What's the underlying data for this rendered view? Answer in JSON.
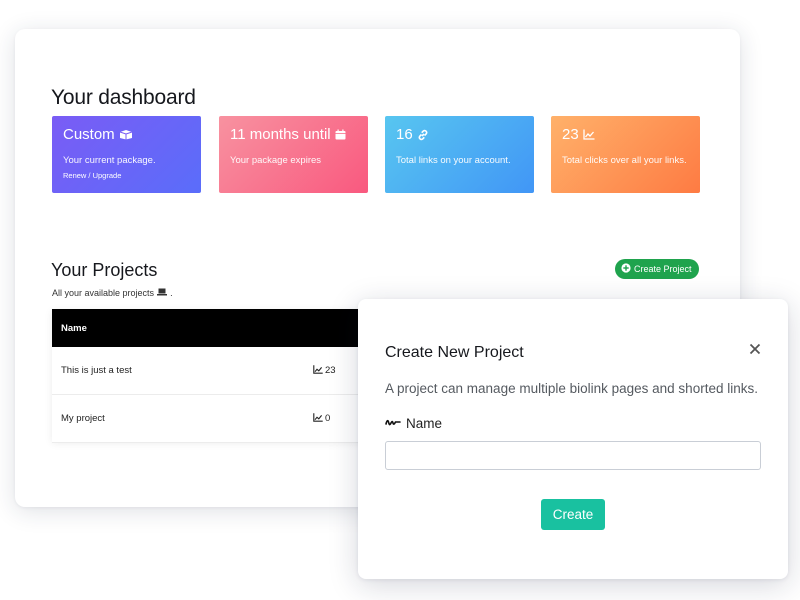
{
  "dashboard": {
    "title": "Your dashboard",
    "cards": [
      {
        "title": "Custom",
        "icon": "package-icon",
        "subtitle": "Your current package.",
        "link": "Renew / Upgrade"
      },
      {
        "title": "11 months until",
        "icon": "calendar-icon",
        "subtitle": "Your package expires"
      },
      {
        "title": "16",
        "icon": "link-icon",
        "subtitle": "Total links on your account."
      },
      {
        "title": "23",
        "icon": "chart-icon",
        "subtitle": "Total clicks over all your links."
      }
    ],
    "card_colors": [
      "#6b63f7",
      "#f9708c",
      "#4aacf3",
      "#fe9556"
    ]
  },
  "projects": {
    "title": "Your Projects",
    "subtitle": "All your available projects",
    "subtitle_suffix": ".",
    "create_button": "Create Project",
    "table_header": {
      "name": "Name"
    },
    "rows": [
      {
        "name": "This is just a test",
        "clicks": "23"
      },
      {
        "name": "My project",
        "clicks": "0"
      }
    ]
  },
  "modal": {
    "title": "Create New Project",
    "description": "A project can manage multiple biolink pages and shorted links.",
    "name_label": "Name",
    "name_value": "",
    "name_placeholder": "",
    "submit": "Create"
  },
  "colors": {
    "create_project_button": "#1fa34d",
    "modal_create_button": "#19c1a0",
    "table_header": "#000000"
  }
}
